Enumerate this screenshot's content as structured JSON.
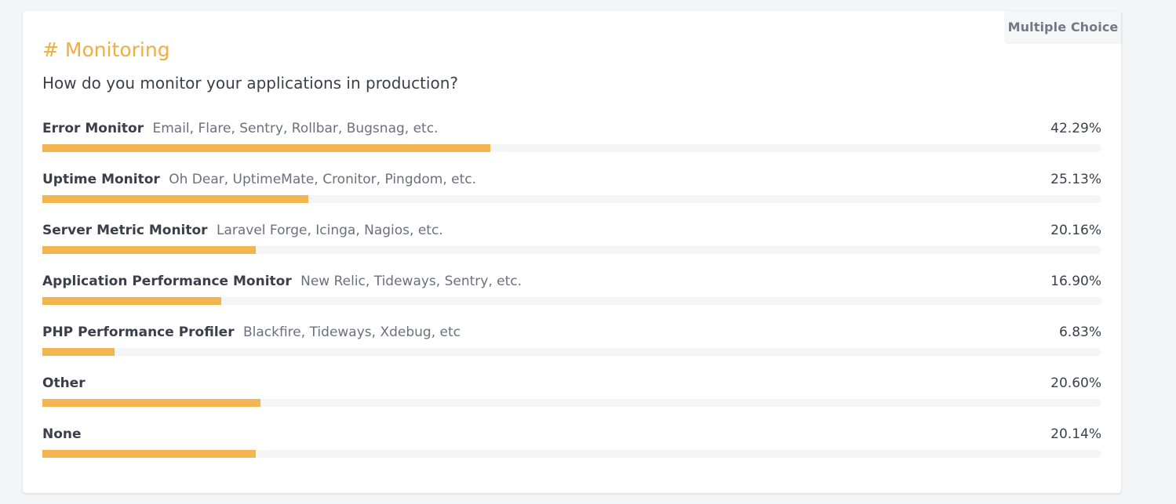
{
  "card": {
    "badge": "Multiple Choice",
    "title": "# Monitoring",
    "question": "How do you monitor your applications in production?"
  },
  "colors": {
    "accent": "#f0ad41",
    "bar_fill": "#f2b54f",
    "track": "#f4f5f7",
    "text": "#3b3f4a",
    "muted": "#6b707c"
  },
  "results": [
    {
      "name": "Error Monitor",
      "desc": "Email, Flare, Sentry, Rollbar, Bugsnag, etc.",
      "percent_label": "42.29%",
      "value": 42.29
    },
    {
      "name": "Uptime Monitor",
      "desc": "Oh Dear, UptimeMate, Cronitor, Pingdom, etc.",
      "percent_label": "25.13%",
      "value": 25.13
    },
    {
      "name": "Server Metric Monitor",
      "desc": "Laravel Forge, Icinga, Nagios, etc.",
      "percent_label": "20.16%",
      "value": 20.16
    },
    {
      "name": "Application Performance Monitor",
      "desc": "New Relic, Tideways, Sentry, etc.",
      "percent_label": "16.90%",
      "value": 16.9
    },
    {
      "name": "PHP Performance Profiler",
      "desc": "Blackfire, Tideways, Xdebug, etc",
      "percent_label": "6.83%",
      "value": 6.83
    },
    {
      "name": "Other",
      "desc": "",
      "percent_label": "20.60%",
      "value": 20.6
    },
    {
      "name": "None",
      "desc": "",
      "percent_label": "20.14%",
      "value": 20.14
    }
  ]
}
